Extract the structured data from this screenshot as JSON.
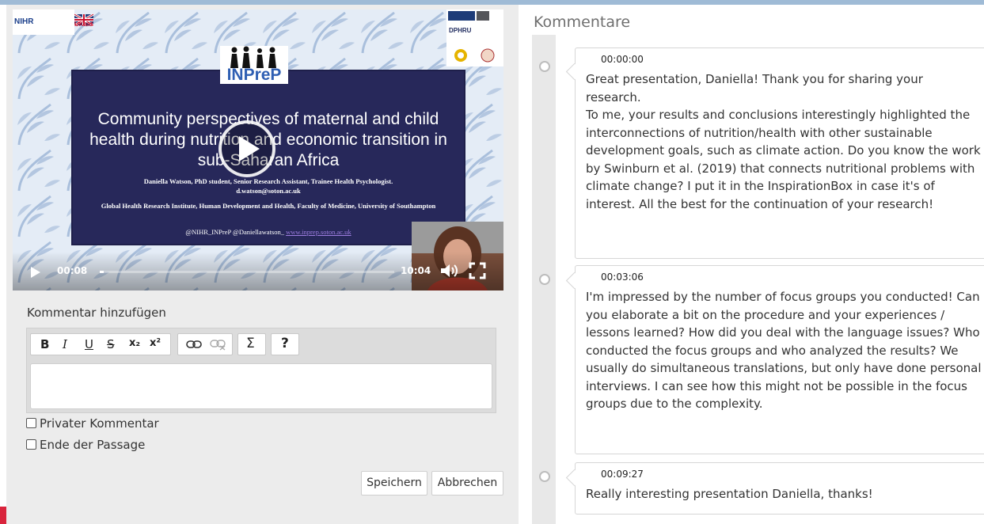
{
  "video": {
    "slide_logo": "INPreP",
    "slide_title": "Community perspectives of maternal and child health during nutrition and economic transition in sub-Saharan Africa",
    "slide_author": "Daniella Watson, PhD student, Senior Research Assistant, Trainee Health Psychologist.",
    "slide_email": "d.watson@soton.ac.uk",
    "slide_institution": "Global Health Research Institute, Human Development and Health, Faculty of Medicine, University of Southampton",
    "slide_handles": "@NIHR_INPreP  @Daniellawatson_",
    "slide_link": "www.inprep.soton.ac.uk",
    "logo_nihr": "NIHR",
    "logo_ukaid": "UKaid",
    "logo_dphru": "DPHRU",
    "current_time": "00:08",
    "total_time": "10:04",
    "progress": 0.013
  },
  "form": {
    "add_comment_label": "Kommentar hinzufügen",
    "toolbar": {
      "bold": "B",
      "italic": "I",
      "underline": "U",
      "strike": "S",
      "subscript": "x₂",
      "superscript": "x²",
      "formula": "Σ",
      "help": "?"
    },
    "private_label": "Privater Kommentar",
    "end_passage_label": "Ende der Passage",
    "save_label": "Speichern",
    "cancel_label": "Abbrechen"
  },
  "comments": {
    "title": "Kommentare",
    "items": [
      {
        "time": "00:00:00",
        "text": "Great presentation, Daniella! Thank you for sharing your research.\nTo me, your results and conclusions interestingly highlighted the interconnections of nutrition/health with other sustainable development goals, such as climate action. Do you know the work by Swinburn et al. (2019) that connects nutritional problems with climate change? I put it in the InspirationBox in case it's of interest. All the best for the continuation of your research!"
      },
      {
        "time": "00:03:06",
        "text": "I'm impressed by the number of focus groups you conducted! Can you elaborate a bit on the procedure and your experiences / lessons learned? How did you deal with the language issues? Who conducted the focus groups and who analyzed the results? We usually do simultaneous translations, but only have done personal interviews. I can see how this might not be possible in the focus groups due to the complexity."
      },
      {
        "time": "00:09:27",
        "text": "Really interesting presentation Daniella, thanks!"
      }
    ]
  },
  "colors": {
    "accent": "#9fbbd6",
    "slide_background": "#27285a",
    "logo_blue": "#2f5fb3",
    "marker_red": "#d9243c"
  },
  "icons": [
    "play-icon",
    "volume-icon",
    "fullscreen-icon",
    "link-icon",
    "unlink-icon"
  ]
}
